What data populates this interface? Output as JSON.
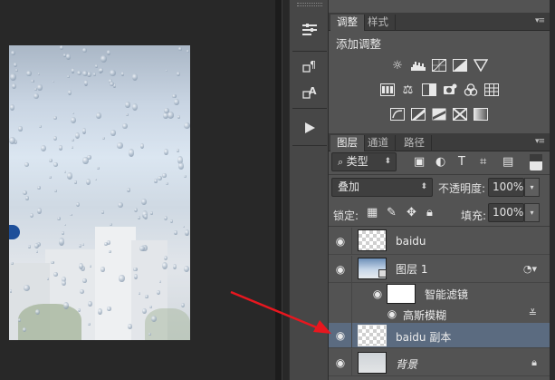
{
  "adjustments_panel": {
    "tabs": [
      {
        "label": "调整",
        "active": true
      },
      {
        "label": "样式",
        "active": false
      }
    ],
    "title": "添加调整",
    "icon_rows": [
      [
        "brightness-icon",
        "levels-icon",
        "curves-icon",
        "exposure-icon",
        "vibrance-icon"
      ],
      [
        "hue-saturation-icon",
        "color-balance-icon",
        "black-white-icon",
        "photo-filter-icon",
        "channel-mixer-icon",
        "color-lookup-icon"
      ],
      [
        "invert-icon",
        "posterize-icon",
        "threshold-icon",
        "selective-color-icon",
        "gradient-map-icon"
      ]
    ]
  },
  "layers_panel": {
    "tabs": [
      {
        "label": "图层",
        "active": true
      },
      {
        "label": "通道",
        "active": false
      },
      {
        "label": "路径",
        "active": false
      }
    ],
    "filter_kind": "类型",
    "blend_mode": "叠加",
    "opacity_label": "不透明度:",
    "opacity_value": "100%",
    "lock_label": "锁定:",
    "fill_label": "填充:",
    "fill_value": "100%",
    "layers": [
      {
        "name": "baidu",
        "thumb": "transparent",
        "selected": false
      },
      {
        "name": "图层 1",
        "thumb": "photo",
        "selected": false
      },
      {
        "name": "智能滤镜",
        "thumb": "white",
        "selected": false
      },
      {
        "name": "高斯模糊",
        "thumb": "none",
        "selected": false
      },
      {
        "name": "baidu 副本",
        "thumb": "transparent",
        "selected": true
      },
      {
        "name": "背景",
        "thumb": "background",
        "selected": false
      }
    ]
  },
  "colors": {
    "panel_bg": "#535353",
    "selected_layer": "#5b6b80",
    "annotation_arrow": "#e8171f"
  }
}
